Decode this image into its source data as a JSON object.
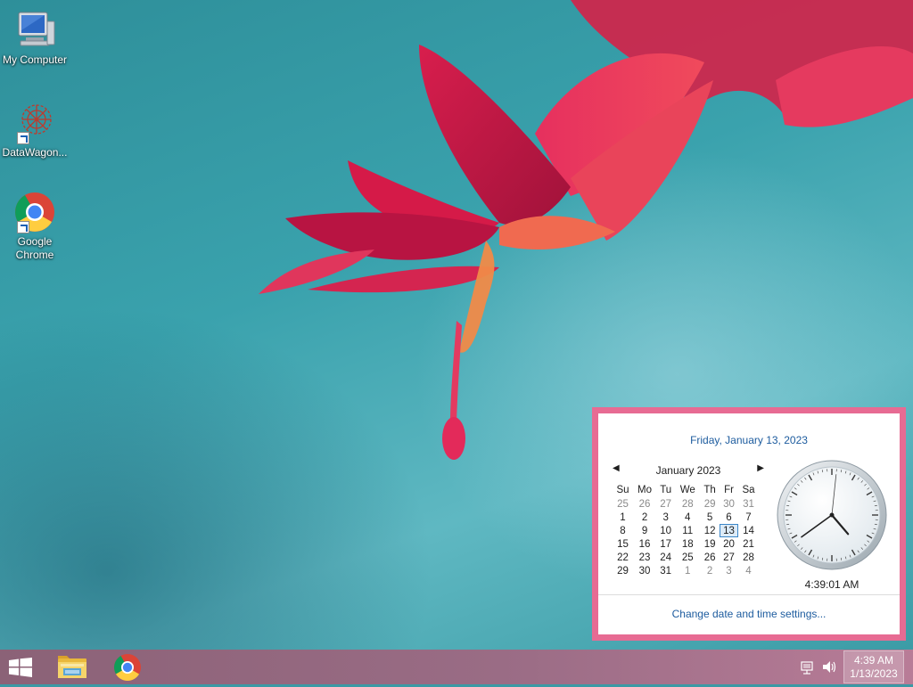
{
  "desktop": {
    "icons": [
      {
        "label": "My Computer",
        "icon": "computer-icon"
      },
      {
        "label": "DataWagon...",
        "icon": "datawagon-icon"
      },
      {
        "label": "Google Chrome",
        "icon": "chrome-icon"
      }
    ]
  },
  "clock_popup": {
    "date_header": "Friday, January 13, 2023",
    "month_label": "January 2023",
    "weekdays": [
      "Su",
      "Mo",
      "Tu",
      "We",
      "Th",
      "Fr",
      "Sa"
    ],
    "weeks": [
      [
        "25",
        "26",
        "27",
        "28",
        "29",
        "30",
        "31"
      ],
      [
        "1",
        "2",
        "3",
        "4",
        "5",
        "6",
        "7"
      ],
      [
        "8",
        "9",
        "10",
        "11",
        "12",
        "13",
        "14"
      ],
      [
        "15",
        "16",
        "17",
        "18",
        "19",
        "20",
        "21"
      ],
      [
        "22",
        "23",
        "24",
        "25",
        "26",
        "27",
        "28"
      ],
      [
        "29",
        "30",
        "31",
        "1",
        "2",
        "3",
        "4"
      ]
    ],
    "selected_day": "13",
    "time_text": "4:39:01 AM",
    "change_link": "Change date and time settings..."
  },
  "taskbar": {
    "apps": [
      {
        "name": "file-explorer",
        "icon": "folder-icon"
      },
      {
        "name": "google-chrome",
        "icon": "chrome-icon"
      }
    ],
    "tray_icons": [
      "network-icon",
      "volume-icon"
    ],
    "clock_time": "4:39 AM",
    "clock_date": "1/13/2023"
  },
  "colors": {
    "popup_border": "#e76b93",
    "link_blue": "#1c5b9e",
    "taskbar": "#9a6c85"
  }
}
